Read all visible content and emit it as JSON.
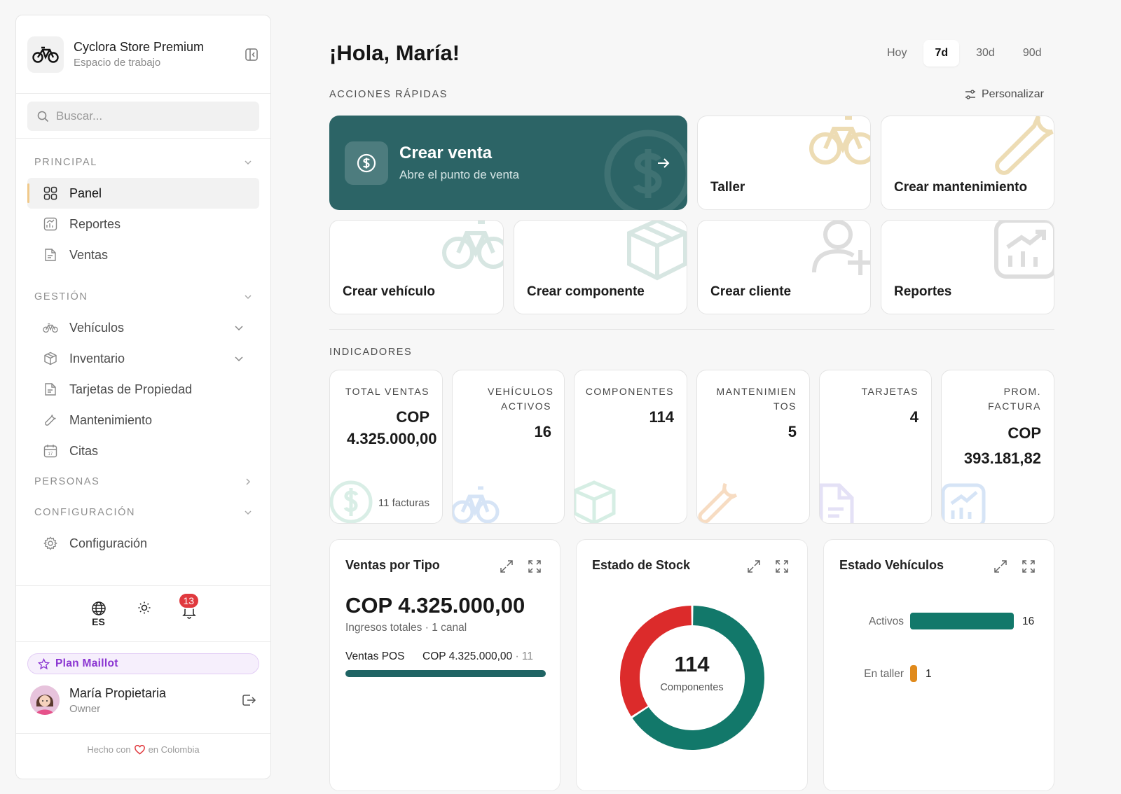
{
  "brand": {
    "name": "Cyclora Store Premium",
    "subtitle": "Espacio de trabajo"
  },
  "search": {
    "placeholder": "Buscar..."
  },
  "sidebar": {
    "sections": [
      {
        "title": "PRINCIPAL",
        "items": [
          {
            "label": "Panel",
            "icon": "grid-icon",
            "active": true
          },
          {
            "label": "Reportes",
            "icon": "reports-icon"
          },
          {
            "label": "Ventas",
            "icon": "document-icon"
          }
        ]
      },
      {
        "title": "GESTIÓN",
        "items": [
          {
            "label": "Vehículos",
            "icon": "bike-icon"
          },
          {
            "label": "Inventario",
            "icon": "box-icon"
          },
          {
            "label": "Tarjetas de Propiedad",
            "icon": "document-icon"
          },
          {
            "label": "Mantenimiento",
            "icon": "wrench-icon"
          },
          {
            "label": "Citas",
            "icon": "calendar-icon"
          }
        ]
      },
      {
        "title": "PERSONAS"
      },
      {
        "title": "CONFIGURACIÓN",
        "items": [
          {
            "label": "Configuración",
            "icon": "gear-icon"
          }
        ]
      }
    ],
    "language": "ES",
    "notifications": "13",
    "plan": "Plan Maillot",
    "user": {
      "name": "María Propietaria",
      "role": "Owner"
    },
    "footer": {
      "before": "Hecho con",
      "after": "en Colombia"
    }
  },
  "header": {
    "greeting": "¡Hola, María!",
    "ranges": [
      "Hoy",
      "7d",
      "30d",
      "90d"
    ],
    "selected_range": "7d"
  },
  "quick_actions": {
    "title": "ACCIONES RÁPIDAS",
    "customize": "Personalizar",
    "primary": {
      "title": "Crear venta",
      "subtitle": "Abre el punto de venta"
    },
    "items": [
      "Taller",
      "Crear mantenimiento",
      "Crear vehículo",
      "Crear componente",
      "Crear cliente",
      "Reportes"
    ]
  },
  "indicators": {
    "title": "INDICADORES",
    "items": [
      {
        "label": "TOTAL VENTAS",
        "value": "COP 4.325.000,00",
        "sub": "11 facturas",
        "color": "#1f8f6a"
      },
      {
        "label": "VEHÍCULOS ACTIVOS",
        "value": "16",
        "color": "#3b7fd6"
      },
      {
        "label": "COMPONENTES",
        "value": "114",
        "color": "#2aa37e"
      },
      {
        "label": "MANTENIMIENTOS",
        "value": "5",
        "color": "#e8862a"
      },
      {
        "label": "TARJETAS",
        "value": "4",
        "color": "#7b6fd6"
      },
      {
        "label": "PROM. FACTURA",
        "value": "COP 393.181,82",
        "color": "#3b7fd6"
      }
    ]
  },
  "panels": {
    "sales": {
      "title": "Ventas por Tipo",
      "amount": "COP 4.325.000,00",
      "subtitle": "Ingresos totales · 1 canal",
      "row": {
        "label": "Ventas POS",
        "value": "COP 4.325.000,00",
        "count": "· 11",
        "share": 1.0
      }
    },
    "stock": {
      "title": "Estado de Stock",
      "total": "114",
      "total_label": "Componentes"
    },
    "vehicles": {
      "title": "Estado Vehículos"
    }
  },
  "chart_data": [
    {
      "type": "pie",
      "title": "Estado de Stock",
      "donut": true,
      "series": [
        {
          "values": [
            75,
            39
          ],
          "colors": [
            "#12786a",
            "#dc2b2b"
          ]
        }
      ]
    },
    {
      "type": "bar",
      "orientation": "horizontal",
      "title": "Estado Vehículos",
      "categories": [
        "Activos",
        "En taller"
      ],
      "values": [
        16,
        1
      ],
      "colors": [
        "#12786a",
        "#e08a1c"
      ]
    }
  ],
  "colors": {
    "accent": "#2c6466",
    "teal": "#12786a",
    "red": "#dc2b2b",
    "orange": "#e08a1c",
    "purple": "#8a34d1",
    "badge": "#e0393e"
  }
}
